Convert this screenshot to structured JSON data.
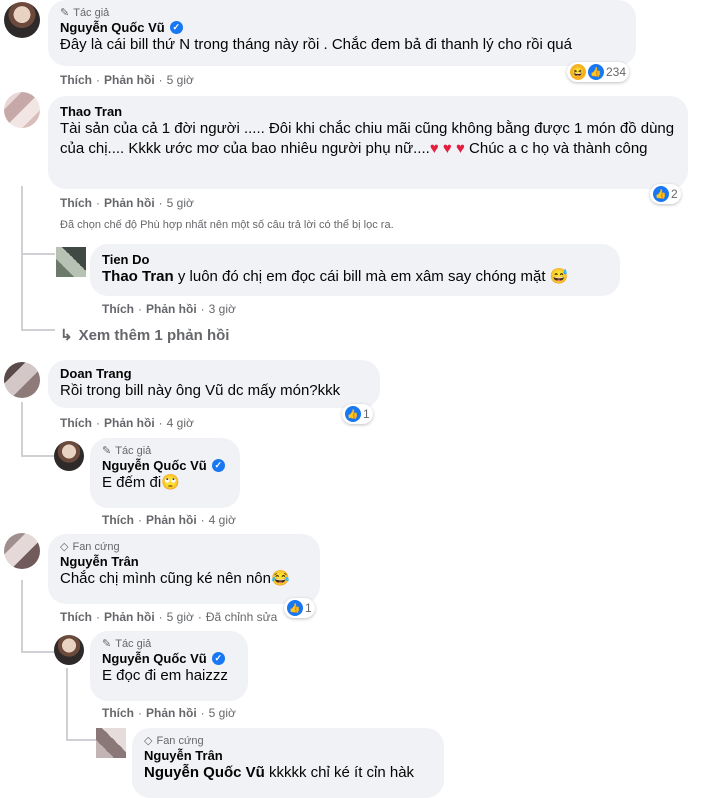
{
  "c1": {
    "badge": "Tác giả",
    "name": "Nguyễn Quốc Vũ",
    "text": "Đây là cái bill thứ N trong tháng này rồi . Chắc đem bả đi thanh lý cho rồi quá",
    "like": "Thích",
    "reply": "Phản hồi",
    "time": "5 giờ",
    "count": "234"
  },
  "c2": {
    "name": "Thao Tran",
    "text": "Tài sản của cả 1 đời người ..... Đôi khi chắc chiu mãi cũng không bằng được 1 món đồ dùng của chị.... Kkkk ước mơ của bao nhiêu người phụ nữ....",
    "hearts": "♥ ♥ ♥",
    "text2": " Chúc a c họ và thành công",
    "like": "Thích",
    "reply": "Phản hồi",
    "time": "5 giờ",
    "count": "2",
    "filter_note": "Đã chọn chế độ Phù hợp nhất nên một số câu trả lời có thể bị lọc ra."
  },
  "c2r": {
    "name": "Tien Do",
    "mention": "Thao Tran",
    "text": " y luôn đó chị em đọc cái bill mà em xâm say chóng mặt",
    "like": "Thích",
    "reply": "Phản hồi",
    "time": "3 giờ"
  },
  "more": {
    "label": "Xem thêm 1 phản hồi"
  },
  "c3": {
    "name": "Doan Trang",
    "text": "Rồi trong bill này ông Vũ dc mấy món?kkk",
    "like": "Thích",
    "reply": "Phản hồi",
    "time": "4 giờ",
    "count": "1"
  },
  "c3r": {
    "badge": "Tác giả",
    "name": "Nguyễn Quốc Vũ",
    "text": "E đếm đi",
    "like": "Thích",
    "reply": "Phản hồi",
    "time": "4 giờ"
  },
  "c4": {
    "badge": "Fan cứng",
    "name": "Nguyễn Trân",
    "text": "Chắc chị mình cũng ké nên nôn",
    "like": "Thích",
    "reply": "Phản hồi",
    "time": "5 giờ",
    "edited": "Đã chỉnh sửa",
    "count": "1"
  },
  "c4r": {
    "badge": "Tác giả",
    "name": "Nguyễn Quốc Vũ",
    "text": "E đọc đi em haizzz",
    "like": "Thích",
    "reply": "Phản hồi",
    "time": "5 giờ"
  },
  "c4r2": {
    "badge": "Fan cứng",
    "name": "Nguyễn Trân",
    "mention": "Nguyễn Quốc Vũ",
    "text": " kkkkk chỉ ké ít cỉn hàk"
  },
  "colors": {
    "bubble": "#f0f2f5",
    "meta": "#65676b",
    "like_blue": "#1877f2",
    "heart": "#e41e3f"
  }
}
